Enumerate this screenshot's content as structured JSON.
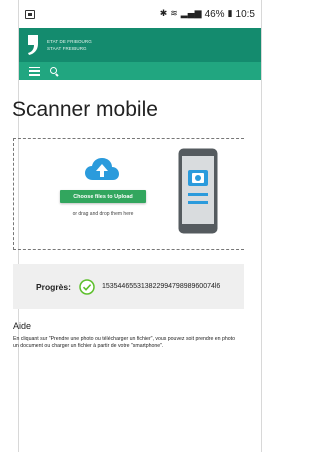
{
  "status_bar": {
    "battery_percent": "46%",
    "time": "10:5"
  },
  "brand": {
    "line1": "ETAT DE FRIBOURG",
    "line2": "STAAT FREIBURG"
  },
  "page": {
    "title": "Scanner mobile"
  },
  "upload": {
    "button_label": "Choose files to Upload",
    "drag_text": "or drag and drop them here"
  },
  "progress": {
    "label": "Progrès:",
    "value": "15354465531382299479898960074l6"
  },
  "help": {
    "title": "Aide",
    "text": "En cliquant sur \"Prendre une photo ou télécharger un fichier\", vous pouvez soit prendre en photo un document ou charger un fichier à partir de votre \"smartphone\"."
  },
  "colors": {
    "brand_green": "#148b6e",
    "nav_green": "#21a680",
    "button_green": "#32a65e",
    "cloud_blue": "#2b9bdc"
  }
}
